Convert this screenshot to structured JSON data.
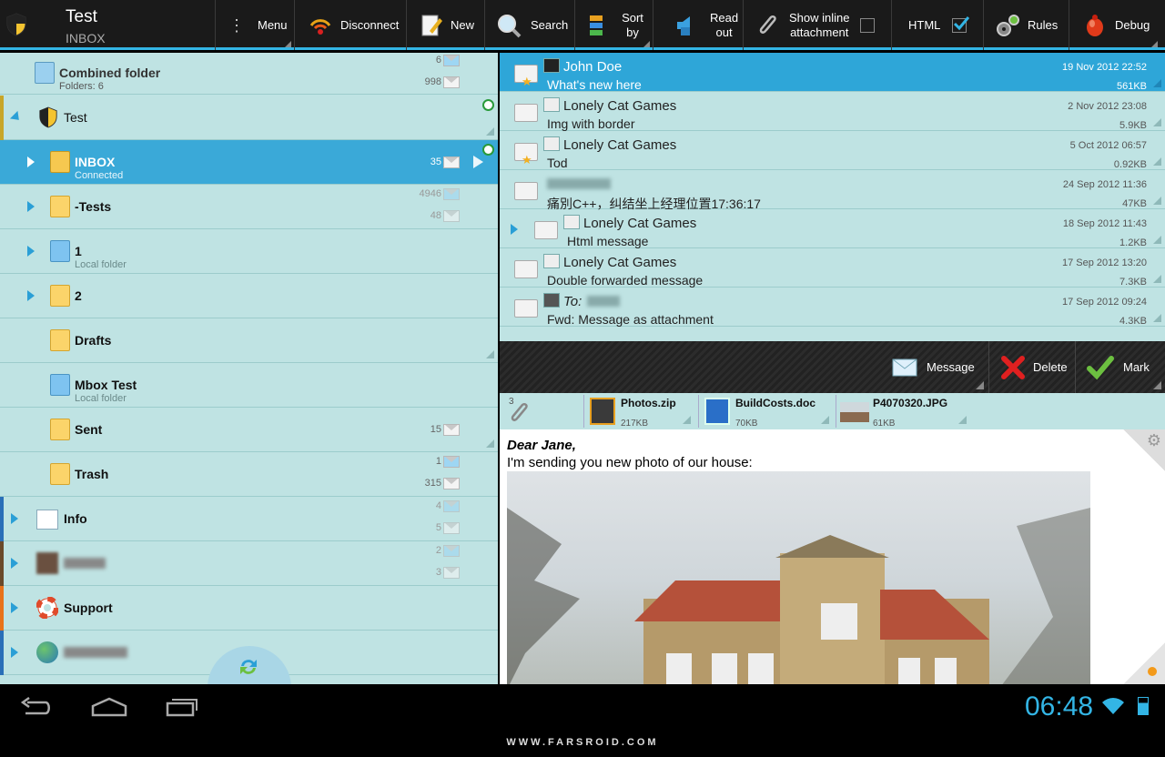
{
  "header": {
    "title": "Test",
    "subtitle": "INBOX"
  },
  "toolbar": {
    "menu": "Menu",
    "disconnect": "Disconnect",
    "new": "New",
    "search": "Search",
    "sort_line1": "Sort",
    "sort_line2": "by",
    "read_line1": "Read",
    "read_line2": "out",
    "show_inline_line1": "Show inline",
    "show_inline_line2": "attachment",
    "show_inline_checked": false,
    "html": "HTML",
    "html_checked": true,
    "rules": "Rules",
    "debug": "Debug"
  },
  "folders": [
    {
      "name": "Combined folder",
      "sub": "Folders: 6",
      "count1": "6",
      "count2": "998"
    },
    {
      "name": "Test"
    },
    {
      "name": "INBOX",
      "sub": "Connected",
      "count1": "35"
    },
    {
      "name": "-Tests",
      "count1": "4946",
      "count2": "48"
    },
    {
      "name": "1",
      "sub": "Local folder"
    },
    {
      "name": "2"
    },
    {
      "name": "Drafts"
    },
    {
      "name": "Mbox Test",
      "sub": "Local folder"
    },
    {
      "name": "Sent",
      "count1": "15"
    },
    {
      "name": "Trash",
      "count1": "1",
      "count2": "315"
    },
    {
      "name": "Info",
      "count1": "4",
      "count2": "5"
    },
    {
      "name": "",
      "count1": "2",
      "count2": "3"
    },
    {
      "name": "Support"
    },
    {
      "name": ""
    }
  ],
  "messages": [
    {
      "from": "John Doe",
      "subject": "What's new here",
      "date": "19 Nov 2012 22:52",
      "size": "561KB"
    },
    {
      "from": "Lonely Cat Games",
      "subject": "Img with border",
      "date": "2 Nov 2012 23:08",
      "size": "5.9KB"
    },
    {
      "from": "Lonely Cat Games",
      "subject": "Tod",
      "date": "5 Oct 2012 06:57",
      "size": "0.92KB"
    },
    {
      "from": "",
      "subject": "痛別C++，纠结坐上经理位置17:36:17",
      "date": "24 Sep 2012 11:36",
      "size": "47KB"
    },
    {
      "from": "Lonely Cat Games",
      "subject": "Html message",
      "date": "18 Sep 2012 11:43",
      "size": "1.2KB"
    },
    {
      "from": "Lonely Cat Games",
      "subject": "Double forwarded message",
      "date": "17 Sep 2012 13:20",
      "size": "7.3KB"
    },
    {
      "from": "To:",
      "subject": "Fwd: Message as attachment",
      "date": "17 Sep 2012 09:24",
      "size": "4.3KB"
    }
  ],
  "actions": {
    "message": "Message",
    "delete": "Delete",
    "mark": "Mark"
  },
  "attachments": {
    "count": "3",
    "items": [
      {
        "name": "Photos.zip",
        "size": "217KB"
      },
      {
        "name": "BuildCosts.doc",
        "size": "70KB"
      },
      {
        "name": "P4070320.JPG",
        "size": "61KB"
      }
    ]
  },
  "body": {
    "greeting": "Dear Jane,",
    "text": "I'm sending you new photo of our house:"
  },
  "statusbar": {
    "time": "06:48"
  },
  "watermark": "WWW.FARSROID.COM",
  "colors": {
    "accent": "#33b5e5",
    "selected": "#3aa9d8",
    "panel": "#bfe3e3"
  }
}
